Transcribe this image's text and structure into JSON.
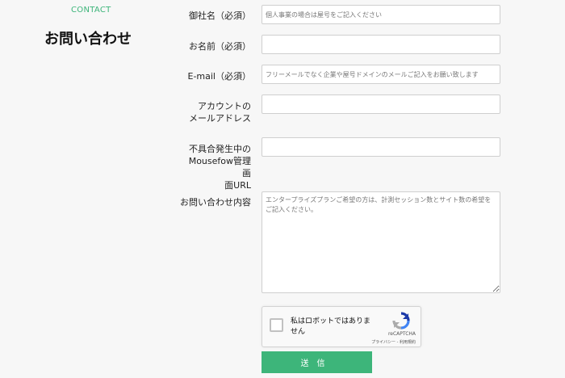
{
  "header": {
    "section_tag": "CONTACT",
    "title": "お問い合わせ"
  },
  "form": {
    "company": {
      "label": "御社名（必須）",
      "placeholder": "個人事業の場合は屋号をご記入ください",
      "value": ""
    },
    "name": {
      "label": "お名前（必須）",
      "placeholder": "",
      "value": ""
    },
    "email": {
      "label": "E-mail（必須）",
      "placeholder": "フリーメールでなく企業や屋号ドメインのメールご記入をお願い致します",
      "value": ""
    },
    "account_email": {
      "label_line1": "アカウントの",
      "label_line2": "メールアドレス",
      "placeholder": "",
      "value": ""
    },
    "issue_url": {
      "label_line1": "不具合発生中の",
      "label_line2": "Mousefow管理画",
      "label_line3": "面URL",
      "placeholder": "",
      "value": ""
    },
    "inquiry": {
      "label": "お問い合わせ内容",
      "placeholder": "エンタープライズプランご希望の方は、計測セッション数とサイト数の希望をご記入ください。",
      "value": ""
    }
  },
  "recaptcha": {
    "label": "私はロボットではありません",
    "brand": "reCAPTCHA",
    "links": "プライバシー - 利用規約",
    "checked": false
  },
  "submit": {
    "label": "送信"
  },
  "colors": {
    "accent": "#3db57a",
    "background": "#f7f7f7",
    "field_border": "#cfcfcf"
  }
}
